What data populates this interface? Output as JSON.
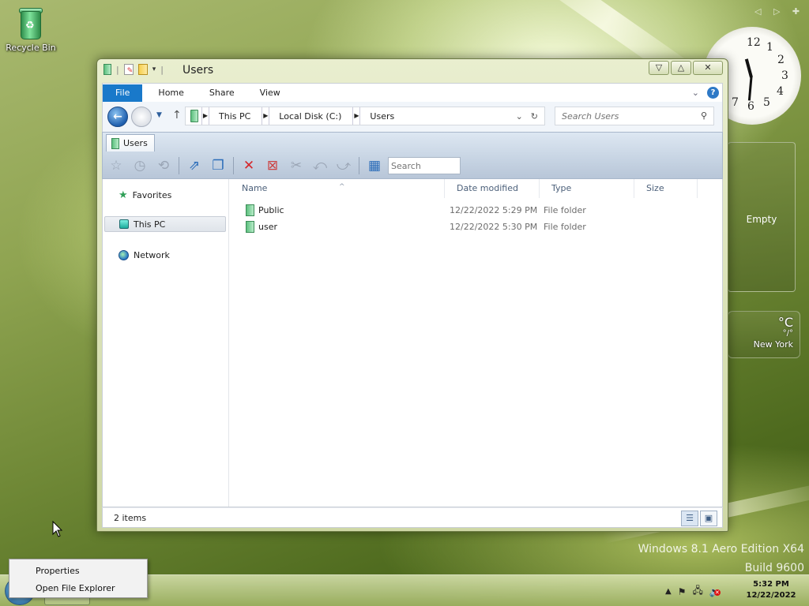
{
  "desktop": {
    "recycle_bin_label": "Recycle Bin",
    "watermark_line1": "Windows 8.1 Aero Edition X64",
    "watermark_line2": "Build 9600",
    "gadget_empty_label": "Empty",
    "weather": {
      "temp": "°C",
      "range": "°/°",
      "city": "New York"
    },
    "clock_numbers": [
      "12",
      "1",
      "2",
      "3",
      "4",
      "5",
      "6",
      "7"
    ]
  },
  "window": {
    "title": "Users",
    "controls": {
      "minimize": "▽",
      "maximize": "△",
      "close": "✕"
    },
    "ribbon_tabs": [
      "File",
      "Home",
      "Share",
      "View"
    ],
    "breadcrumbs": [
      "This PC",
      "Local Disk (C:)",
      "Users"
    ],
    "search_placeholder": "Search Users",
    "path_tab_label": "Users",
    "toolbar_search_placeholder": "Search",
    "nav_pane": [
      "Favorites",
      "This PC",
      "Network"
    ],
    "selected_nav": "This PC",
    "columns": [
      "Name",
      "Date modified",
      "Type",
      "Size"
    ],
    "files": [
      {
        "name": "Public",
        "date": "12/22/2022 5:29 PM",
        "type": "File folder"
      },
      {
        "name": "user",
        "date": "12/22/2022 5:30 PM",
        "type": "File folder"
      }
    ],
    "status": "2 items"
  },
  "context_menu": {
    "items": [
      "Properties",
      "Open File Explorer"
    ]
  },
  "taskbar": {
    "time": "5:32 PM",
    "date": "12/22/2022"
  },
  "colors": {
    "accent": "#1979ca",
    "wallpaper": "#6f8836",
    "delete_red": "#d5262a"
  }
}
